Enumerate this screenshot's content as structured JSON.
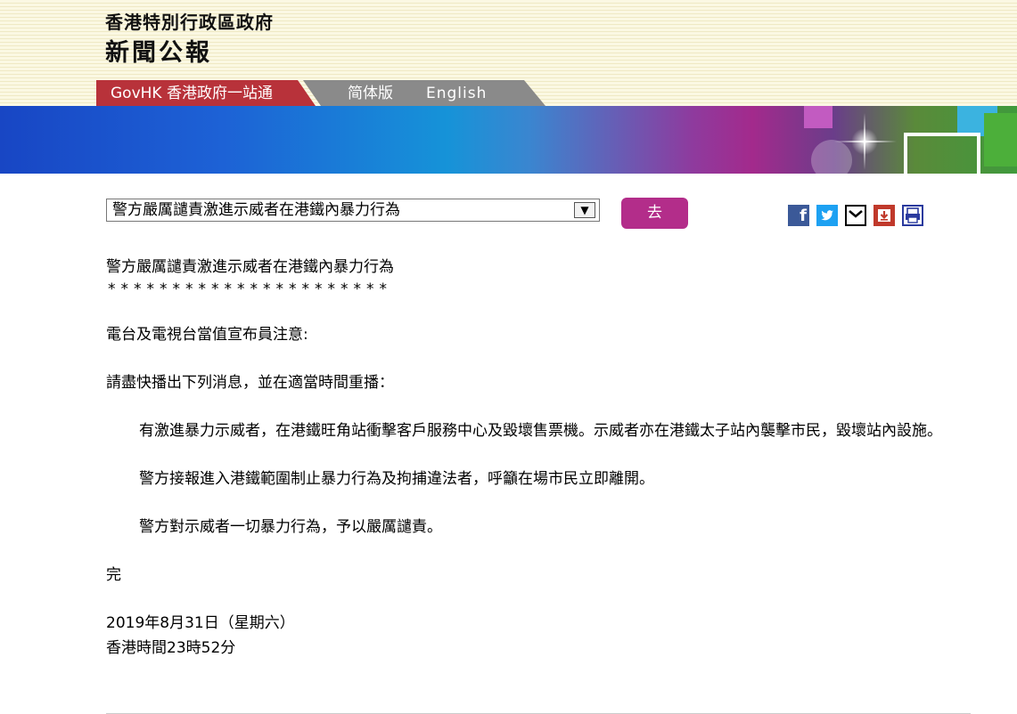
{
  "header": {
    "org_name": "香港特別行政區政府",
    "brand": "新聞公報",
    "tabs": {
      "govhk": "GovHK 香港政府一站通",
      "simplified": "简体版",
      "english": "English"
    }
  },
  "toolbar": {
    "selected_headline": "警方嚴厲譴責激進示威者在港鐵內暴力行為",
    "go_label": "去",
    "share_icons": [
      "facebook-icon",
      "twitter-icon",
      "email-icon",
      "download-icon",
      "print-icon"
    ]
  },
  "article": {
    "title": "警方嚴厲譴責激進示威者在港鐵內暴力行為",
    "separator": "**********************",
    "notice": "電台及電視台當值宣布員注意:",
    "request": "請盡快播出下列消息，並在適當時間重播：",
    "paragraphs": [
      "有激進暴力示威者，在港鐵旺角站衝擊客戶服務中心及毀壞售票機。示威者亦在港鐵太子站內襲擊市民，毀壞站內設施。",
      "警方接報進入港鐵範圍制止暴力行為及拘捕違法者，呼籲在場市民立即離開。",
      "警方對示威者一切暴力行為，予以嚴厲譴責。"
    ],
    "end": "完",
    "date": "2019年8月31日（星期六）",
    "time": "香港時間23時52分"
  },
  "colors": {
    "govhk_tab": "#b8323a",
    "lang_tab": "#8a8a8a",
    "go_button": "#b32d8a",
    "header_bg": "#fbf8e3"
  }
}
